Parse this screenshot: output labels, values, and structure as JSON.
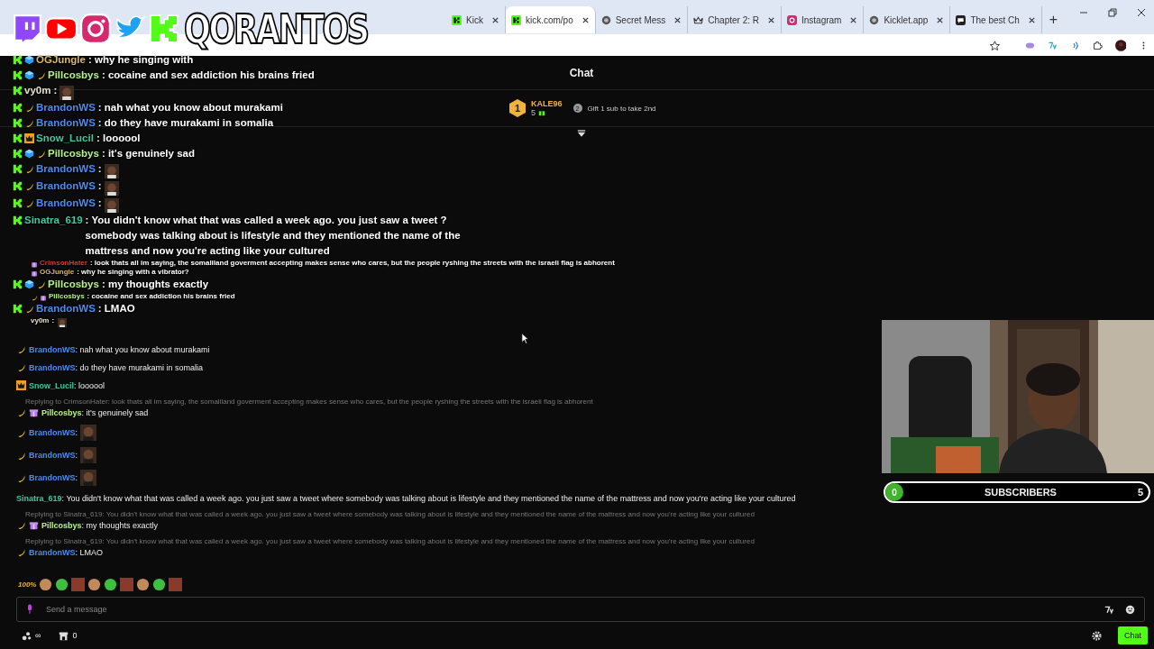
{
  "logo": {
    "text": "QORANTOS"
  },
  "tabs": [
    {
      "label": "Kick",
      "kind": "kick",
      "selected": false
    },
    {
      "label": "kick.com/po",
      "kind": "kick",
      "selected": true
    },
    {
      "label": "Secret Mess",
      "kind": "globe",
      "selected": false
    },
    {
      "label": "Chapter 2: R",
      "kind": "crown",
      "selected": false
    },
    {
      "label": "Instagram",
      "kind": "instagram",
      "selected": false
    },
    {
      "label": "Kicklet.app",
      "kind": "globe",
      "selected": false
    },
    {
      "label": "The best Ch",
      "kind": "chat",
      "selected": false
    }
  ],
  "new_tab": "+",
  "chat_title": "Chat",
  "leaderboard": {
    "rank": "1",
    "user": "KALE96",
    "count": "5",
    "next_rank": "2",
    "hint": "Gift 1 sub to take 2nd"
  },
  "overlay_chat": [
    {
      "kind": "large",
      "badges": [
        {
          "kind": "kick"
        },
        {
          "kind": "cube"
        }
      ],
      "user": "OGJungle",
      "color": "#d9b86a",
      "text": ": why he singing with"
    },
    {
      "kind": "large",
      "badges": [
        {
          "kind": "kick"
        },
        {
          "kind": "cube"
        },
        {
          "kind": "banana"
        }
      ],
      "user": "Pillcosbys",
      "color": "#b6f28a",
      "text": ": cocaine and sex addiction his brains fried"
    },
    {
      "kind": "large",
      "badges": [
        {
          "kind": "kick"
        }
      ],
      "user": "vy0m",
      "color": "#e8e0c8",
      "text": ":",
      "emote": true
    },
    {
      "kind": "large",
      "badges": [
        {
          "kind": "kick"
        },
        {
          "kind": "banana"
        }
      ],
      "user": "BrandonWS",
      "color": "#4a8cf0",
      "text": ": nah what you know about murakami"
    },
    {
      "kind": "large",
      "badges": [
        {
          "kind": "kick"
        },
        {
          "kind": "banana"
        }
      ],
      "user": "BrandonWS",
      "color": "#4a8cf0",
      "text": ": do they have murakami in somalia"
    },
    {
      "kind": "large",
      "badges": [
        {
          "kind": "kick"
        },
        {
          "kind": "crown"
        }
      ],
      "user": "Snow_Lucil",
      "color": "#3cc9a0",
      "text": ": loooool"
    },
    {
      "kind": "large",
      "badges": [
        {
          "kind": "kick"
        },
        {
          "kind": "cube"
        },
        {
          "kind": "banana"
        }
      ],
      "user": "Pillcosbys",
      "color": "#b6f28a",
      "text": ": it's genuinely sad"
    },
    {
      "kind": "large",
      "badges": [
        {
          "kind": "kick"
        },
        {
          "kind": "banana"
        }
      ],
      "user": "BrandonWS",
      "color": "#4a8cf0",
      "text": ":",
      "emote": true
    },
    {
      "kind": "large",
      "badges": [
        {
          "kind": "kick"
        },
        {
          "kind": "banana"
        }
      ],
      "user": "BrandonWS",
      "color": "#4a8cf0",
      "text": ":",
      "emote": true
    },
    {
      "kind": "large",
      "badges": [
        {
          "kind": "kick"
        },
        {
          "kind": "banana"
        }
      ],
      "user": "BrandonWS",
      "color": "#4a8cf0",
      "text": ":",
      "emote": true
    },
    {
      "kind": "large",
      "badges": [
        {
          "kind": "kick"
        }
      ],
      "user": "Sinatra_619",
      "color": "#3cc9a0",
      "text": ": You didn't know what that was called a week ago. you just saw a tweet ? somebody was talking about is lifestyle and they mentioned the name of the mattress and now you're acting like your cultured"
    },
    {
      "kind": "small",
      "badges": [
        {
          "kind": "gift"
        }
      ],
      "user": "CrimsonHater",
      "color": "#d63a3a",
      "text": ": look thats all im saying, the somaliland goverment accepting makes sense who cares, but the people ryshing the streets with the israeli flag is abhorent"
    },
    {
      "kind": "small",
      "badges": [
        {
          "kind": "gift"
        }
      ],
      "user": "OGJungle",
      "color": "#d9b86a",
      "text": ": why he singing with a vibrator?"
    },
    {
      "kind": "large",
      "badges": [
        {
          "kind": "kick"
        },
        {
          "kind": "cube"
        },
        {
          "kind": "banana"
        }
      ],
      "user": "Pillcosbys",
      "color": "#b6f28a",
      "text": ": my thoughts exactly"
    },
    {
      "kind": "small",
      "badges": [
        {
          "kind": "banana"
        },
        {
          "kind": "gift"
        }
      ],
      "user": "Pillcosbys",
      "color": "#b6f28a",
      "text": ": cocaine and sex addiction his brains fried"
    },
    {
      "kind": "large",
      "badges": [
        {
          "kind": "kick"
        },
        {
          "kind": "banana"
        }
      ],
      "user": "BrandonWS",
      "color": "#4a8cf0",
      "text": ": LMAO"
    },
    {
      "kind": "small",
      "user": "vy0m",
      "color": "#e8e0c8",
      "text": ":",
      "emote": true
    }
  ],
  "messages": [
    {
      "badges": [
        {
          "kind": "banana"
        }
      ],
      "user": "BrandonWS",
      "color": "#4a8cf0",
      "text": ": nah what you know about murakami"
    },
    {
      "badges": [
        {
          "kind": "banana"
        }
      ],
      "user": "BrandonWS",
      "color": "#4a8cf0",
      "text": ": do they have murakami in somalia"
    },
    {
      "badges": [
        {
          "kind": "crown"
        }
      ],
      "user": "Snow_Lucil",
      "color": "#3cc9a0",
      "text": ": loooool"
    },
    {
      "reply_to": "Replying to CrimsonHater: look thats all im saying, the somaliland goverment accepting makes sense who cares, but the people ryshing the streets with the israeli flag is abhorent",
      "badges": [
        {
          "kind": "banana"
        },
        {
          "kind": "gift"
        }
      ],
      "user": "Pillcosbys",
      "color": "#b6f28a",
      "text": ": it's genuinely sad"
    },
    {
      "badges": [
        {
          "kind": "banana"
        }
      ],
      "user": "BrandonWS",
      "color": "#4a8cf0",
      "text": ":",
      "emote": true
    },
    {
      "badges": [
        {
          "kind": "banana"
        }
      ],
      "user": "BrandonWS",
      "color": "#4a8cf0",
      "text": ":",
      "emote": true
    },
    {
      "badges": [
        {
          "kind": "banana"
        }
      ],
      "user": "BrandonWS",
      "color": "#4a8cf0",
      "text": ":",
      "emote": true
    },
    {
      "user": "Sinatra_619",
      "color": "#3cc9a0",
      "text": ": You didn't know what that was called a week ago. you just saw a tweet where somebody was talking about is lifestyle and they mentioned the name of the mattress and now you're acting like your cultured"
    },
    {
      "reply_to": "Replying to Sinatra_619: You didn't know what that was called a week ago. you just saw a tweet where somebody was talking about is lifestyle and they mentioned the name of the mattress and now you're acting like your cultured",
      "badges": [
        {
          "kind": "banana"
        },
        {
          "kind": "gift"
        }
      ],
      "user": "Pillcosbys",
      "color": "#b6f28a",
      "text": ": my thoughts exactly"
    },
    {
      "reply_to": "Replying to Sinatra_619: You didn't know what that was called a week ago. you just saw a tweet where somebody was talking about is lifestyle and they mentioned the name of the mattress and now you're acting like your cultured",
      "badges": [
        {
          "kind": "banana"
        }
      ],
      "user": "BrandonWS",
      "color": "#4a8cf0",
      "text": ": LMAO"
    }
  ],
  "emote_strip": {
    "first": "100%"
  },
  "input": {
    "placeholder": "Send a message"
  },
  "points": "∞",
  "store_count": "0",
  "chat_button": "Chat",
  "subscriber_goal": {
    "current": "0",
    "label": "SUBSCRIBERS",
    "goal": "5"
  }
}
